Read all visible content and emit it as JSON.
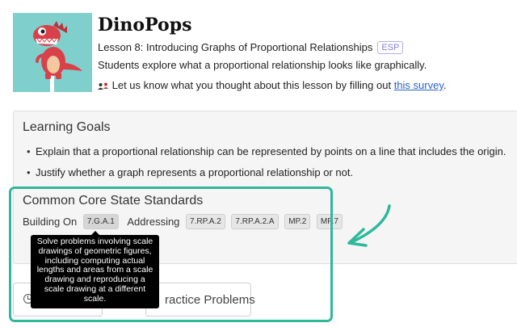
{
  "lesson": {
    "title": "DinoPops",
    "subtitle": "Lesson 8: Introducing Graphs of Proportional Relationships",
    "esp_badge": "ESP",
    "description": "Students explore what a proportional relationship looks like graphically.",
    "survey_text": "Let us know what you thought about this lesson by filling out",
    "survey_link": "this survey",
    "survey_end": ".",
    "thumbnail_icon": "dinosaur-illustration",
    "survey_icon": "chat-people-icon"
  },
  "learning_goals": {
    "heading": "Learning Goals",
    "items": [
      "Explain that a proportional relationship can be represented by points on a line that includes the origin.",
      "Justify whether a graph represents a proportional relationship or not."
    ]
  },
  "standards": {
    "heading": "Common Core State Standards",
    "building_on_label": "Building On",
    "building_on": [
      "7.G.A.1"
    ],
    "addressing_label": "Addressing",
    "addressing": [
      "7.RP.A.2",
      "7.RP.A.2.A",
      "MP.2",
      "MP.7"
    ]
  },
  "tooltip": {
    "text": "Solve problems involving scale drawings of geometric figures, including computing actual lengths and areas from a scale drawing and reproducing a scale drawing at a different scale."
  },
  "buttons": {
    "left_icon": "clock-icon",
    "right_label": "ractice Problems"
  },
  "annotation": {
    "color": "#2fb89a",
    "icon": "curved-arrow-icon"
  }
}
